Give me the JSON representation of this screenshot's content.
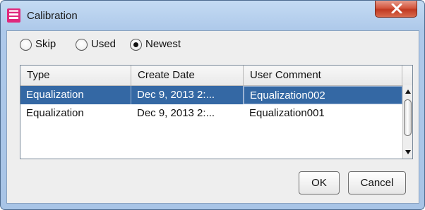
{
  "window": {
    "title": "Calibration",
    "icon": "calibration-app-icon",
    "close_icon": "close-icon"
  },
  "mode": {
    "options": [
      {
        "label": "Skip",
        "checked": false
      },
      {
        "label": "Used",
        "checked": false
      },
      {
        "label": "Newest",
        "checked": true
      }
    ]
  },
  "table": {
    "columns": [
      "Type",
      "Create Date",
      "User Comment"
    ],
    "rows": [
      {
        "type": "Equalization",
        "create_date": "Dec 9, 2013 2:...",
        "comment": "Equalization002",
        "selected": true
      },
      {
        "type": "Equalization",
        "create_date": "Dec 9, 2013 2:...",
        "comment": "Equalization001",
        "selected": false
      }
    ]
  },
  "buttons": {
    "ok": "OK",
    "cancel": "Cancel"
  },
  "colors": {
    "selection": "#3468a4",
    "close_button": "#c9482f",
    "app_icon": "#e0287c"
  }
}
